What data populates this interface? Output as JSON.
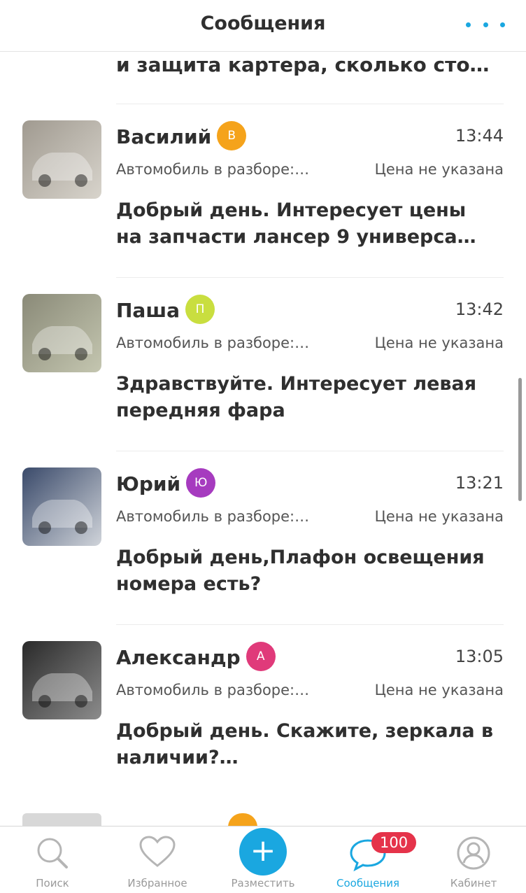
{
  "header": {
    "title": "Сообщения",
    "more_icon": "more-dots-icon"
  },
  "partial_message": "и защита картера, сколько сто…",
  "conversations": [
    {
      "name": "Василий",
      "initial": "В",
      "badge_color": "#f5a31b",
      "time": "13:44",
      "subject": "Автомобиль в разборе:…",
      "price": "Цена не указана",
      "message": "Добрый день. Интересует цены на запчасти лансер 9 универса…",
      "thumb_colors": [
        "#a09a90",
        "#d8d4cc"
      ]
    },
    {
      "name": "Паша",
      "initial": "П",
      "badge_color": "#c9de3f",
      "time": "13:42",
      "subject": "Автомобиль в разборе:…",
      "price": "Цена не указана",
      "message": "Здравствуйте. Интересует левая передняя фара",
      "thumb_colors": [
        "#8a8a78",
        "#c4c6b0"
      ]
    },
    {
      "name": "Юрий",
      "initial": "Ю",
      "badge_color": "#a63bbf",
      "time": "13:21",
      "subject": "Автомобиль в разборе:…",
      "price": "Цена не указана",
      "message": "Добрый день,Плафон освещения номера есть?",
      "thumb_colors": [
        "#3a4a6a",
        "#d0d4da"
      ]
    },
    {
      "name": "Александр",
      "initial": "А",
      "badge_color": "#e03a7a",
      "time": "13:05",
      "subject": "Автомобиль в разборе:…",
      "price": "Цена не указана",
      "message": "Добрый день. Скажите, зеркала в наличии?…",
      "thumb_colors": [
        "#2a2a2a",
        "#8c8c8c"
      ]
    }
  ],
  "tabs": [
    {
      "label": "Поиск",
      "icon": "search-icon",
      "active": false
    },
    {
      "label": "Избранное",
      "icon": "heart-icon",
      "active": false
    },
    {
      "label": "Разместить",
      "icon": "plus-icon",
      "active": false
    },
    {
      "label": "Сообщения",
      "icon": "chat-icon",
      "active": true,
      "count": "100"
    },
    {
      "label": "Кабинет",
      "icon": "user-icon",
      "active": false
    }
  ]
}
